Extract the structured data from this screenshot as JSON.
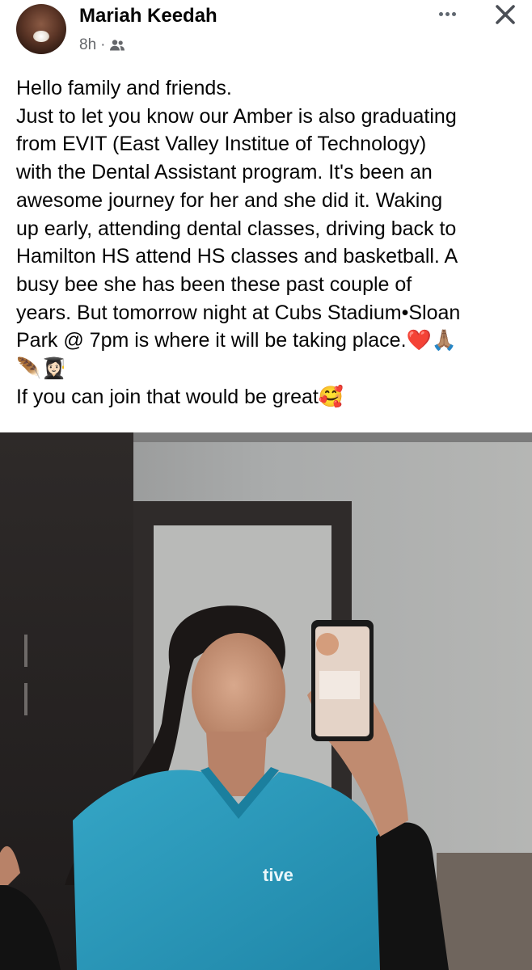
{
  "post": {
    "author": "Mariah Keedah",
    "time": "8h",
    "separator": "·",
    "audience_icon": "friends-icon",
    "lines": [
      "Hello family and friends.",
      "Just to let you know our Amber is also graduating",
      "from EVIT (East Valley Institue of Technology)",
      "with the Dental Assistant program. It's been an",
      "awesome journey for her and she did it. Waking",
      "up early, attending dental classes, driving back to",
      "Hamilton HS attend HS classes and basketball. A",
      "busy bee she has been these past couple of",
      "years. But tomorrow night at Cubs Stadium•Sloan",
      "Park @ 7pm is where it will be taking place."
    ],
    "line_emojis": [
      "❤️",
      "🙏🏽"
    ],
    "emoji_line": [
      "🪶",
      "👩🏻‍🎓"
    ],
    "closing_line": "If you can join that would be great",
    "closing_emoji": "🥰"
  },
  "photo": {
    "shirt_text": "tive",
    "description_icon": "mirror-selfie-photo"
  },
  "colors": {
    "text": "#050505",
    "meta": "#65676b",
    "scrubs": "#2f9fc0"
  }
}
